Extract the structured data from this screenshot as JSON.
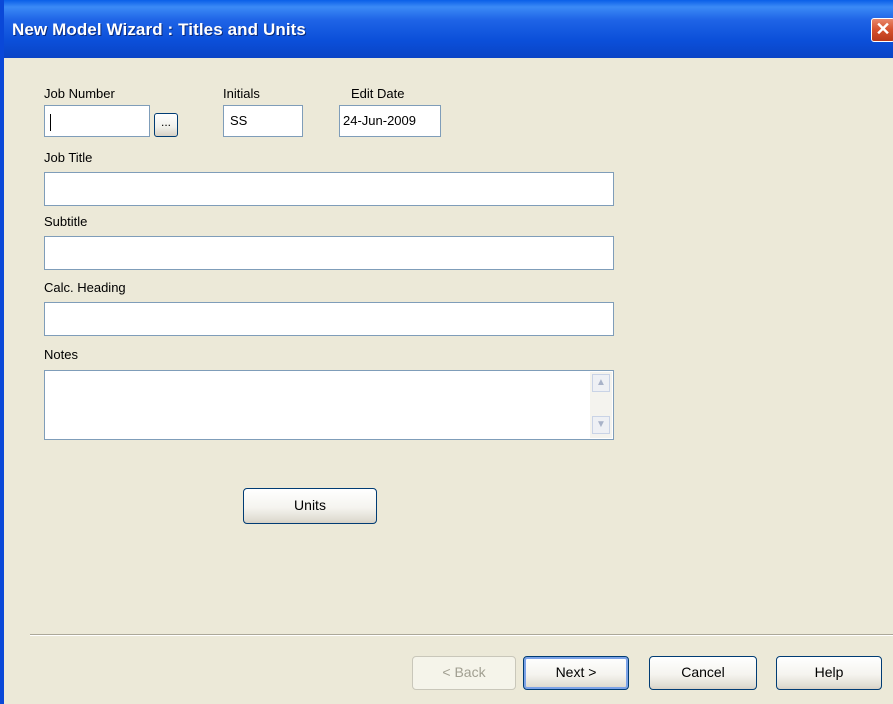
{
  "window": {
    "title": "New Model Wizard : Titles and Units",
    "close_glyph": "✕"
  },
  "form": {
    "job_number": {
      "label": "Job Number",
      "value": ""
    },
    "browse_label": "...",
    "initials": {
      "label": "Initials",
      "value": "SS"
    },
    "edit_date": {
      "label": "Edit Date",
      "value": "24-Jun-2009"
    },
    "job_title": {
      "label": "Job Title",
      "value": ""
    },
    "subtitle": {
      "label": "Subtitle",
      "value": ""
    },
    "calc_heading": {
      "label": "Calc. Heading",
      "value": ""
    },
    "notes": {
      "label": "Notes",
      "value": ""
    },
    "scroll_up_glyph": "▲",
    "scroll_down_glyph": "▼"
  },
  "buttons": {
    "units": "Units",
    "back": "< Back",
    "next": "Next >",
    "cancel": "Cancel",
    "help": "Help"
  },
  "colors": {
    "titlebar": "#0A4FD9",
    "dialog_background": "#ECE9D8",
    "close_button": "#D5502C",
    "field_border": "#7F9DB9"
  }
}
